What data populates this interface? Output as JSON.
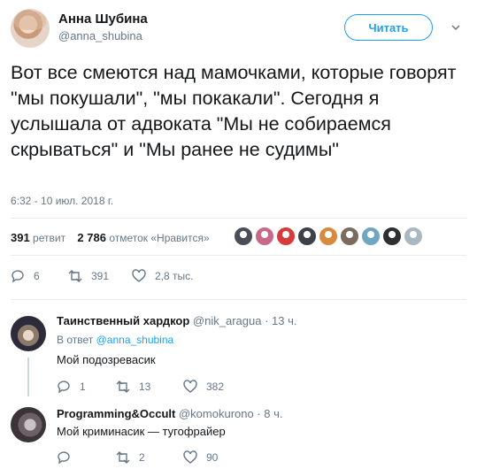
{
  "tweet": {
    "author_name": "Анна Шубина",
    "author_handle": "@anna_shubina",
    "follow_label": "Читать",
    "text": "Вот все смеются над мамочками, которые говорят \"мы покушали\", \"мы покакали\". Сегодня я услышала от адвоката \"Мы не собираемся скрываться\" и \"Мы ранее не судимы\"",
    "timestamp": "6:32 - 10 июл. 2018 г.",
    "retweets_count": "391",
    "retweets_label": "ретвит",
    "likes_count": "2 786",
    "likes_label": "отметок «Нравится»",
    "likers": [
      {
        "color": "#4a4f57"
      },
      {
        "color": "#c76a8a"
      },
      {
        "color": "#d93b3b"
      },
      {
        "color": "#3d4148"
      },
      {
        "color": "#d98a3f"
      },
      {
        "color": "#7b6a5e"
      },
      {
        "color": "#6fa7c2"
      },
      {
        "color": "#2d2f33"
      },
      {
        "color": "#aab8c2"
      }
    ],
    "actions": {
      "replies": "6",
      "retweets": "391",
      "likes": "2,8 тыс."
    }
  },
  "replies": [
    {
      "name": "Таинственный хардкор",
      "handle": "@nik_aragua",
      "time": "· 13 ч.",
      "reply_to_prefix": "В ответ",
      "reply_to": "@anna_shubina",
      "text": "Мой подозревасик",
      "actions": {
        "replies": "1",
        "retweets": "13",
        "likes": "382"
      }
    },
    {
      "name": "Programming&Occult",
      "handle": "@komokurono",
      "time": "· 8 ч.",
      "text": "Мой криминасик — тугофрайер",
      "actions": {
        "replies": "",
        "retweets": "2",
        "likes": "90"
      }
    }
  ],
  "colors": {
    "accent": "#1da1f2",
    "muted": "#657786",
    "text": "#14171a",
    "divider": "#e6ecf0"
  },
  "icons": {
    "reply": "reply-icon",
    "retweet": "retweet-icon",
    "like": "heart-icon",
    "menu": "chevron-down-icon"
  }
}
